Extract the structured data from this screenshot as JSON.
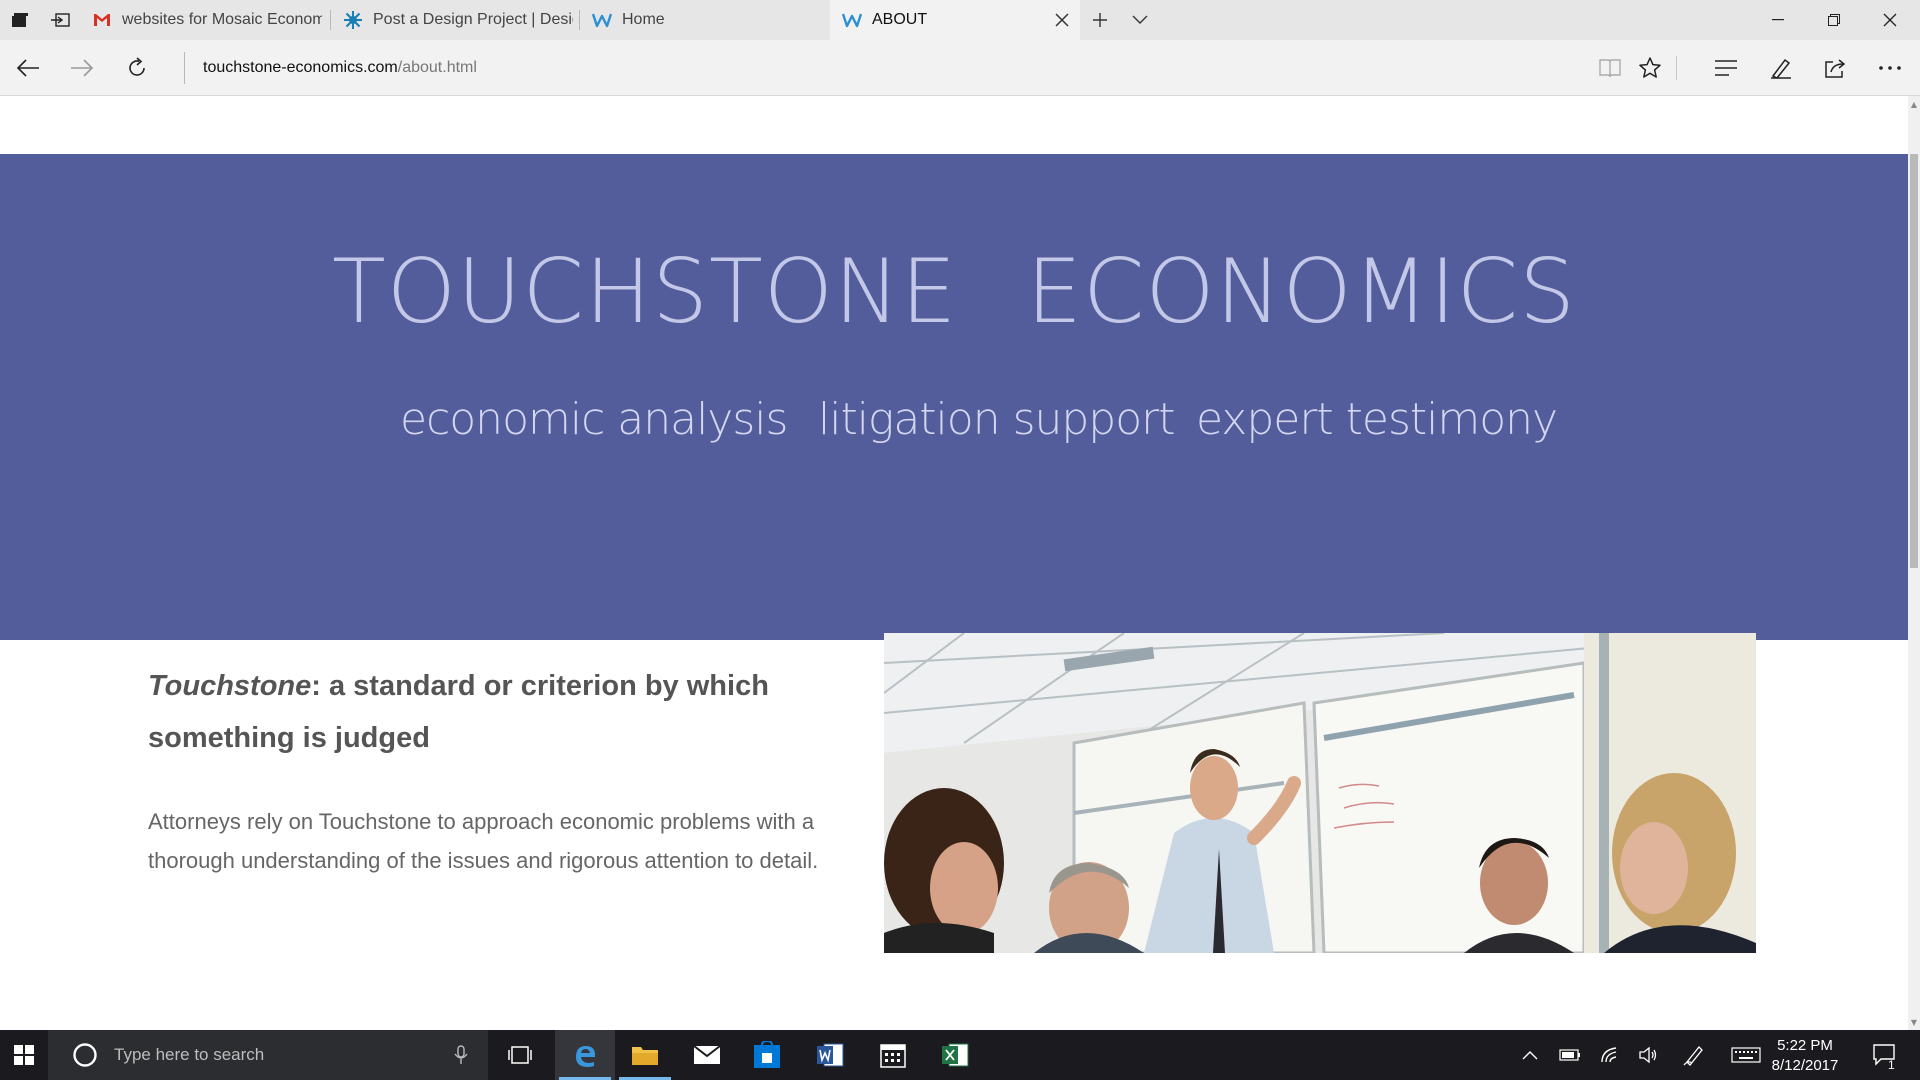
{
  "browser": {
    "tabs": [
      {
        "title": "websites for Mosaic Econom",
        "favicon": "gmail-icon"
      },
      {
        "title": "Post a Design Project | Desig",
        "favicon": "starburst-icon"
      },
      {
        "title": "Home",
        "favicon": "weebly-icon"
      },
      {
        "title": "ABOUT",
        "favicon": "weebly-icon",
        "active": true
      }
    ],
    "url_host": "touchstone-economics.com",
    "url_path": "/about.html"
  },
  "page": {
    "brand": "TOUCHSTONE  ECONOMICS",
    "taglines": [
      "economic analysis",
      "litigation support",
      "expert testimony"
    ],
    "definition_term": "Touchstone",
    "definition_rest": ": a standard or criterion by which something is judged",
    "body": "Attorneys rely on Touchstone to approach economic problems with a thorough understanding of the issues and rigorous attention to detail.",
    "hero_color": "#535d9b"
  },
  "taskbar": {
    "search_placeholder": "Type here to search",
    "time": "5:22 PM",
    "date": "8/12/2017",
    "notification_count": "1"
  }
}
